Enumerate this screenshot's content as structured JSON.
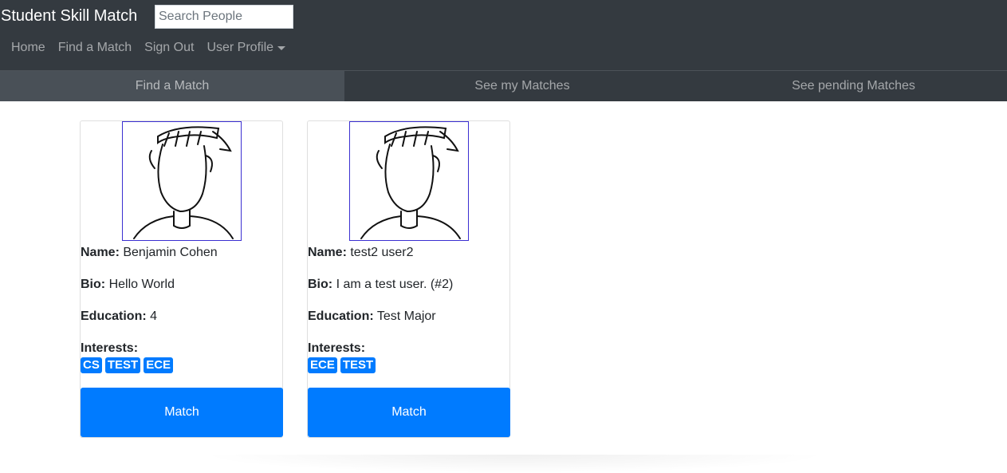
{
  "navbar": {
    "brand": "Student Skill Match",
    "search_placeholder": "Search People",
    "links": [
      {
        "label": "Home"
      },
      {
        "label": "Find a Match"
      },
      {
        "label": "Sign Out"
      },
      {
        "label": "User Profile"
      }
    ]
  },
  "tabs": [
    {
      "label": "Find a Match",
      "active": true
    },
    {
      "label": "See my Matches",
      "active": false
    },
    {
      "label": "See pending Matches",
      "active": false
    }
  ],
  "field_labels": {
    "name": "Name:",
    "bio": "Bio:",
    "education": "Education:",
    "interests": "Interests:"
  },
  "cards": [
    {
      "name": "Benjamin Cohen",
      "bio": "Hello World",
      "education": "4",
      "interests": [
        "CS",
        "TEST",
        "ECE"
      ],
      "button_label": "Match"
    },
    {
      "name": "test2 user2",
      "bio": "I am a test user. (#2)",
      "education": "Test Major",
      "interests": [
        "ECE",
        "TEST"
      ],
      "button_label": "Match"
    }
  ],
  "colors": {
    "navbar_bg": "#343a40",
    "active_tab_bg": "#495057",
    "primary": "#007bff"
  },
  "icons": {
    "avatar": "person-sketch-avatar"
  }
}
